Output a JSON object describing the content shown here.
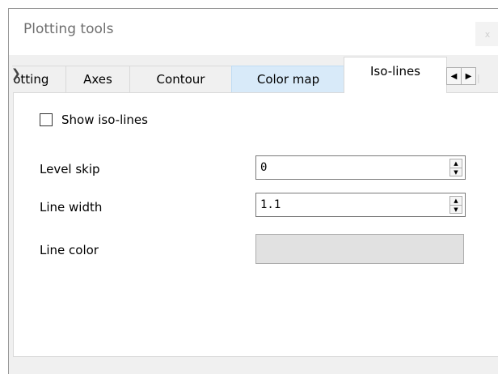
{
  "window": {
    "title": "Plotting tools",
    "close_label": "x"
  },
  "tabs": [
    {
      "label": "Plotting",
      "state": "partial"
    },
    {
      "label": "Axes",
      "state": "normal"
    },
    {
      "label": "Contour",
      "state": "normal"
    },
    {
      "label": "Color map",
      "state": "hover"
    },
    {
      "label": "Iso-lines",
      "state": "selected"
    }
  ],
  "tab_scroll": {
    "left_icon": "scroll-left-icon",
    "right_icon": "scroll-right-icon",
    "left_glyph": "◀",
    "right_glyph": "▶"
  },
  "iso_lines": {
    "show_checkbox": {
      "label": "Show iso-lines",
      "checked": false
    },
    "level_skip": {
      "label": "Level skip",
      "value": "0"
    },
    "line_width": {
      "label": "Line width",
      "value": "1.1"
    },
    "line_color": {
      "label": "Line color",
      "color": "#e1e1e1"
    }
  },
  "colors": {
    "window_bg": "#f0f0f0",
    "panel_bg": "#ffffff",
    "hover_tab": "#d8eaf9",
    "swatch": "#e1e1e1"
  }
}
